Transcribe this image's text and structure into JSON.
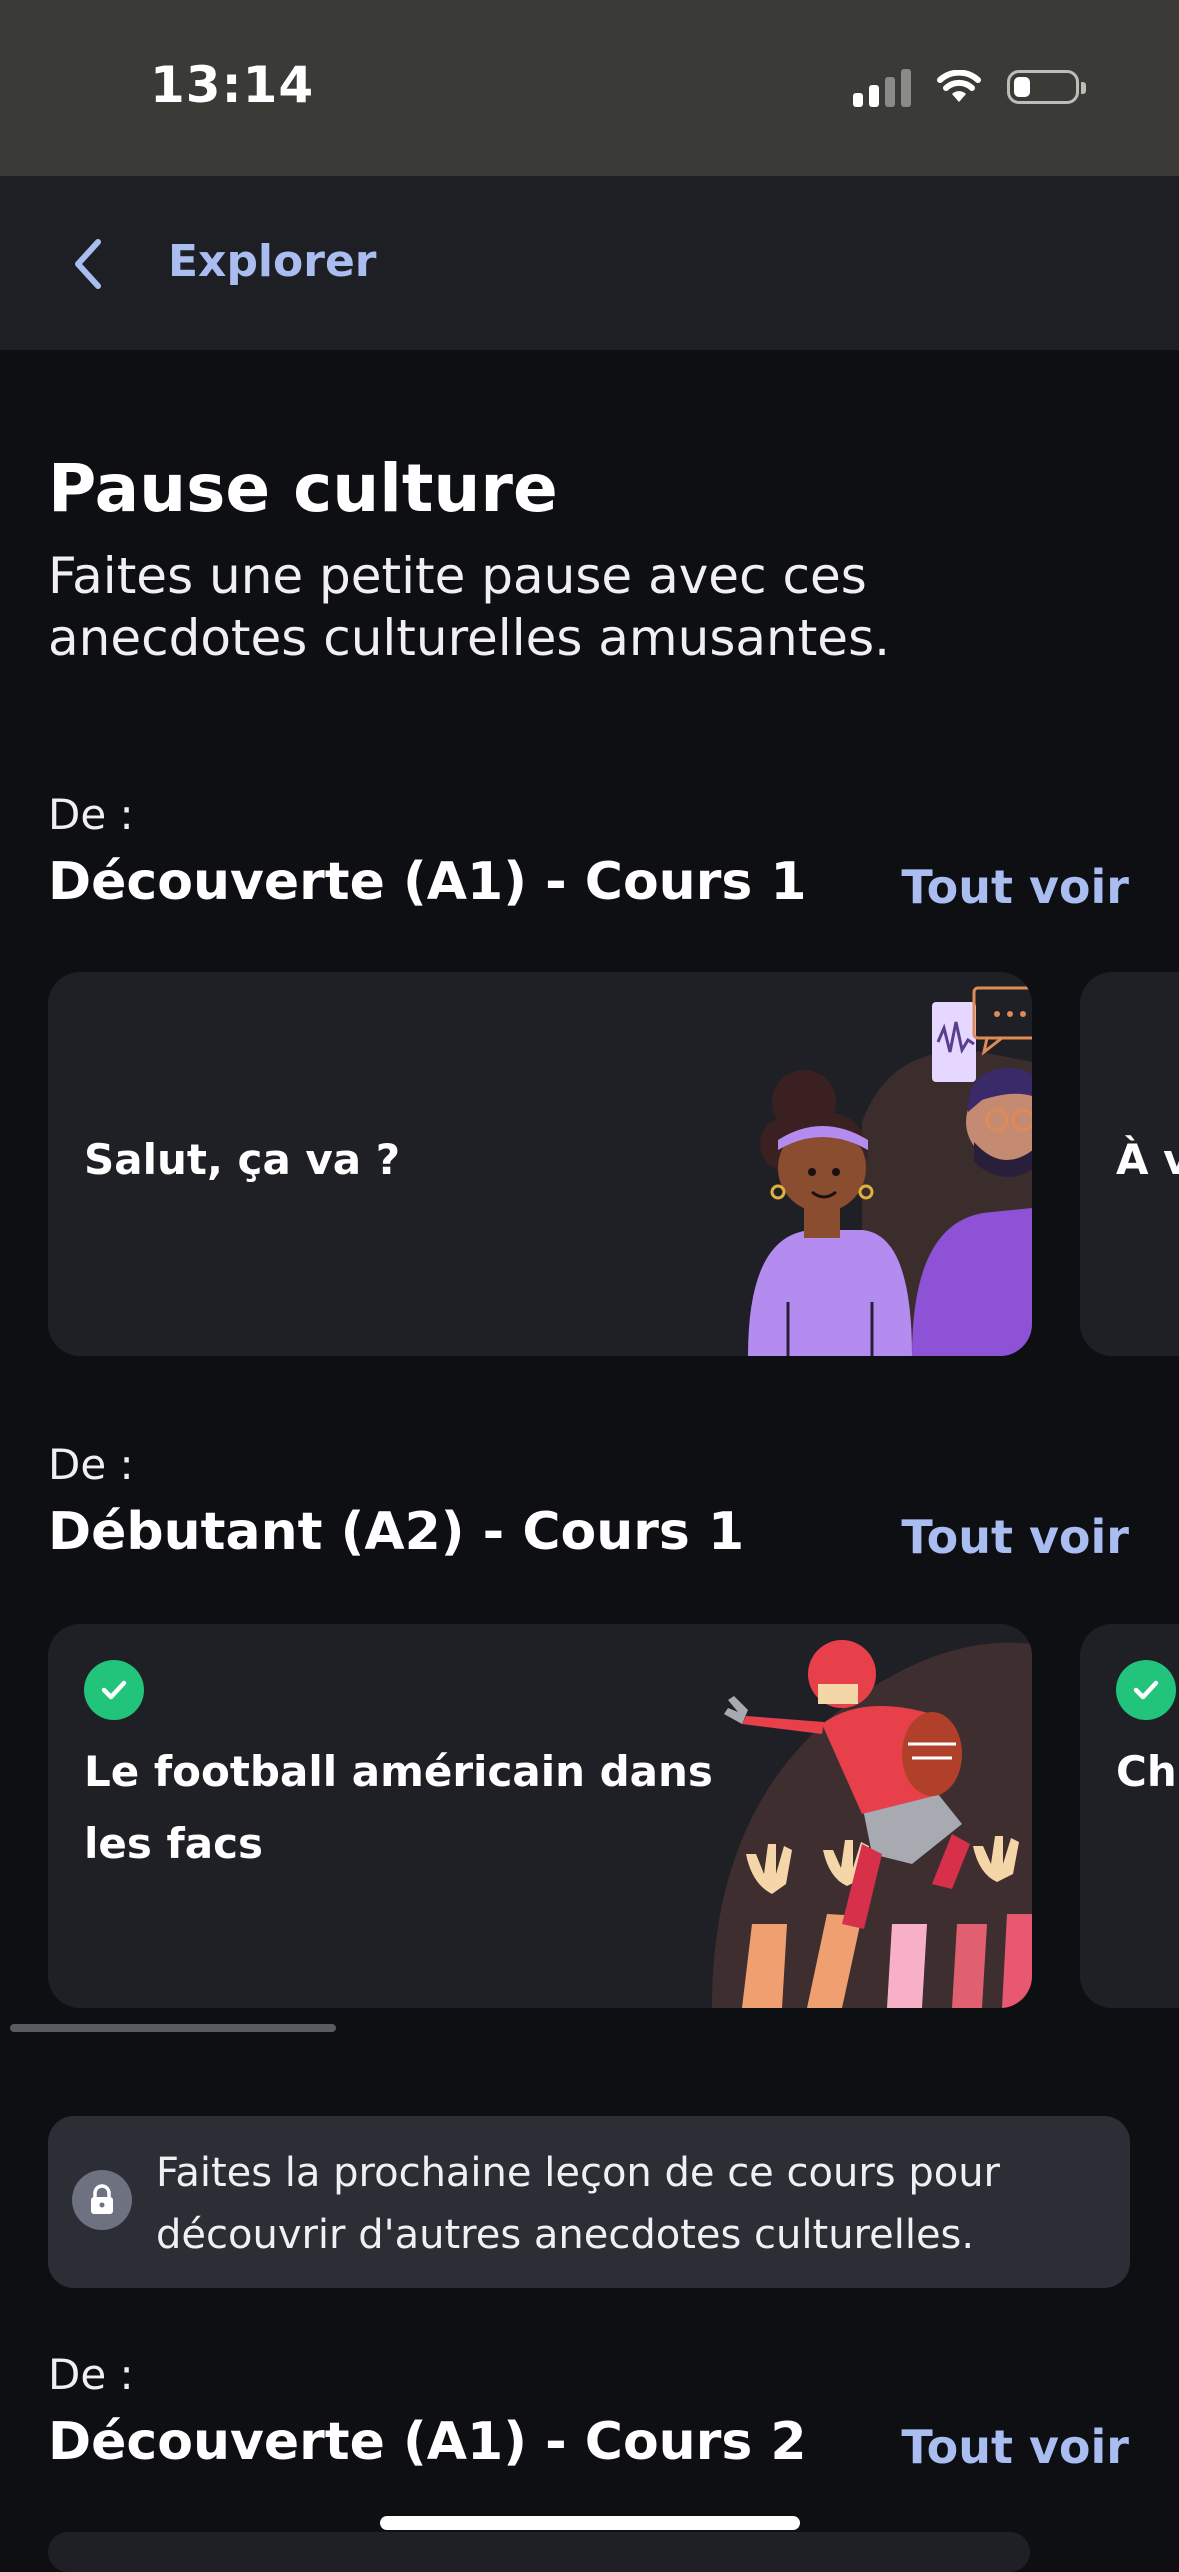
{
  "status_bar": {
    "time": "13:14",
    "battery_level": 0.2
  },
  "nav": {
    "back_icon": "chevron-left-icon",
    "title": "Explorer"
  },
  "page": {
    "title": "Pause culture",
    "subtitle": "Faites une petite pause avec ces anecdotes culturelles amusantes."
  },
  "sections": [
    {
      "label": "De :",
      "title": "Découverte (A1) - Cours 1",
      "see_all": "Tout voir",
      "cards": [
        {
          "title": "Salut, ça va ?",
          "completed": false,
          "art": "two-people-chatting-illustration"
        },
        {
          "title": "À v",
          "completed": false
        }
      ]
    },
    {
      "label": "De :",
      "title": "Débutant (A2) - Cours 1",
      "see_all": "Tout voir",
      "cards": [
        {
          "title": "Le football américain dans les facs",
          "completed": true,
          "art": "football-player-crowd-illustration"
        },
        {
          "title": "Ch",
          "completed": true
        }
      ]
    },
    {
      "label": "De :",
      "title": "Découverte (A1) - Cours 2",
      "see_all": "Tout voir"
    }
  ],
  "lock_banner": {
    "icon": "lock-icon",
    "text": "Faites la prochaine leçon de ce cours pour découvrir d'autres anecdotes culturelles."
  },
  "colors": {
    "accent": "#a9bdf0",
    "check": "#22c47b",
    "card_bg": "#1f2026",
    "background": "#0e0f12"
  }
}
